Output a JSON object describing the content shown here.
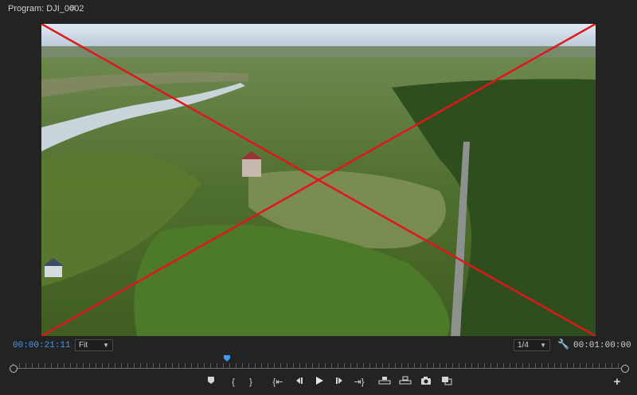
{
  "header": {
    "title": "Program: DJI_0002",
    "menu_icon": "hamburger-menu-icon"
  },
  "viewer": {
    "content": "aerial drone footage of forest and river with red X overlay",
    "overlay_color": "#e0161a"
  },
  "timecode": {
    "current": "00:00:21:11",
    "duration": "00:01:00:00",
    "current_color": "#3a9bff"
  },
  "zoom": {
    "value": "Fit"
  },
  "resolution": {
    "value": "1/4"
  },
  "timeline": {
    "playhead_position_fraction": 0.35
  },
  "controls": [
    {
      "name": "add-marker-button",
      "icon": "marker-icon",
      "glyph": "⬟"
    },
    {
      "name": "mark-in-button",
      "icon": "mark-in-icon",
      "glyph": "{"
    },
    {
      "name": "mark-out-button",
      "icon": "mark-out-icon",
      "glyph": "}"
    },
    {
      "name": "go-to-in-button",
      "icon": "go-to-in-icon",
      "glyph": "{⇤"
    },
    {
      "name": "step-back-button",
      "icon": "step-back-icon",
      "glyph": "◀|"
    },
    {
      "name": "play-button",
      "icon": "play-icon",
      "glyph": "▶"
    },
    {
      "name": "step-forward-button",
      "icon": "step-forward-icon",
      "glyph": "|▶"
    },
    {
      "name": "go-to-out-button",
      "icon": "go-to-out-icon",
      "glyph": "⇥}"
    },
    {
      "name": "lift-button",
      "icon": "lift-icon",
      "glyph": "⛫"
    },
    {
      "name": "extract-button",
      "icon": "extract-icon",
      "glyph": "⛬"
    },
    {
      "name": "export-frame-button",
      "icon": "camera-icon",
      "glyph": "📷"
    },
    {
      "name": "comparison-view-button",
      "icon": "comparison-view-icon",
      "glyph": "◧"
    },
    {
      "name": "button-editor-button",
      "icon": "plus-icon",
      "glyph": "+"
    }
  ]
}
